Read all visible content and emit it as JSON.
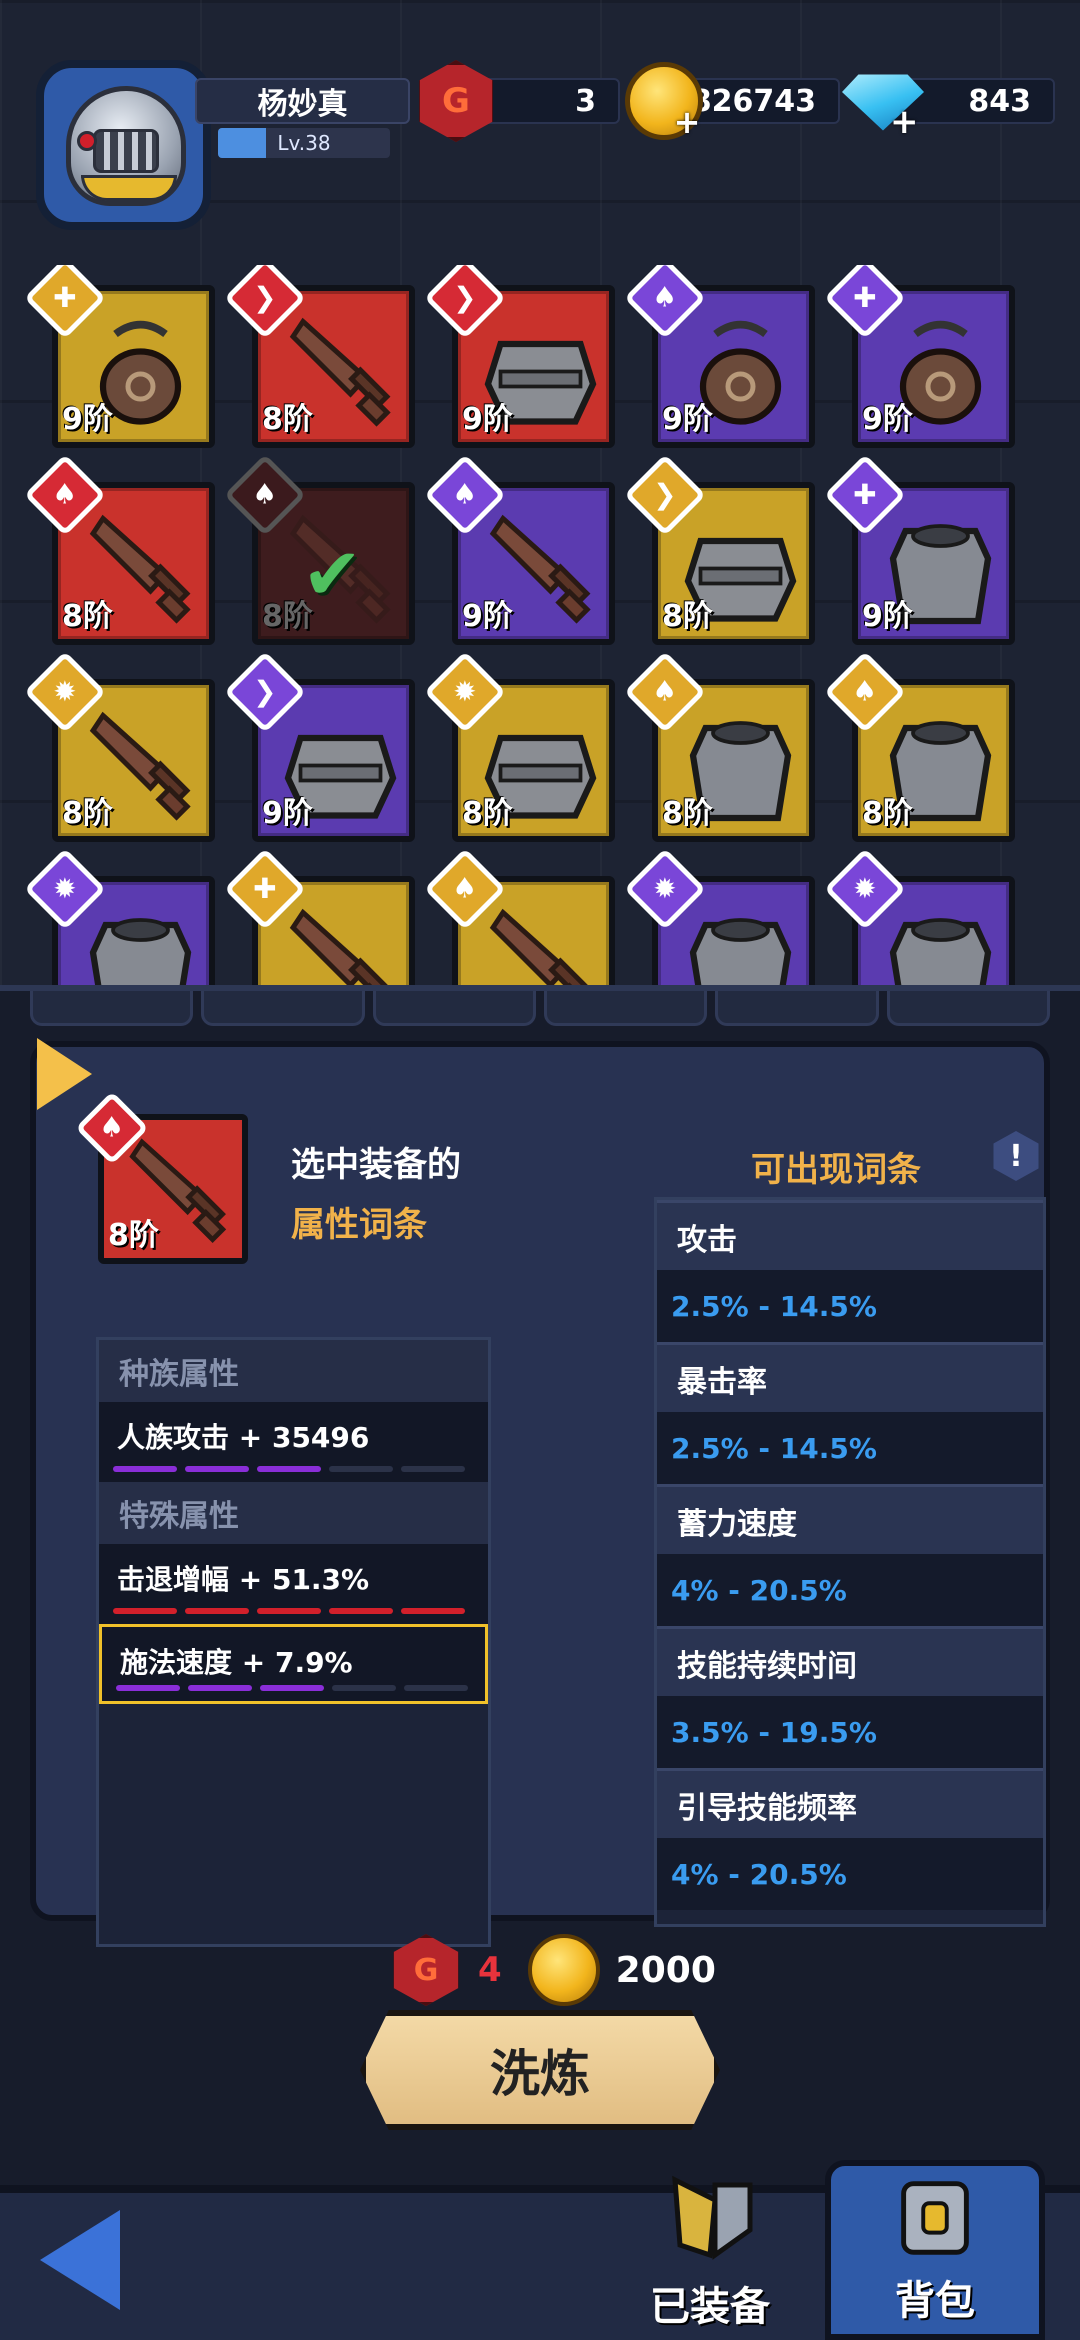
{
  "player": {
    "name": "杨妙真",
    "level": "Lv.38",
    "level_progress": 0.28
  },
  "currencies": {
    "gems": "3",
    "gold": "4826743",
    "diamonds": "843"
  },
  "items": [
    {
      "tier": "9阶",
      "color": "gold",
      "badge": "gold-wrench",
      "kind": "bag"
    },
    {
      "tier": "8阶",
      "color": "red",
      "badge": "red-wing",
      "kind": "sword"
    },
    {
      "tier": "9阶",
      "color": "red",
      "badge": "red-wing",
      "kind": "armor"
    },
    {
      "tier": "9阶",
      "color": "purple",
      "badge": "purple-flame",
      "kind": "bag"
    },
    {
      "tier": "9阶",
      "color": "purple",
      "badge": "purple-wrench",
      "kind": "bag"
    },
    {
      "tier": "8阶",
      "color": "red",
      "badge": "red-flame",
      "kind": "sword"
    },
    {
      "tier": "8阶",
      "color": "dim",
      "badge": "dim-flame",
      "kind": "sword",
      "equipped": true
    },
    {
      "tier": "9阶",
      "color": "purple",
      "badge": "purple-flame",
      "kind": "sword"
    },
    {
      "tier": "8阶",
      "color": "gold",
      "badge": "gold-wing",
      "kind": "armor"
    },
    {
      "tier": "9阶",
      "color": "purple",
      "badge": "purple-wrench",
      "kind": "vest"
    },
    {
      "tier": "8阶",
      "color": "gold",
      "badge": "gold-crest",
      "kind": "sword"
    },
    {
      "tier": "9阶",
      "color": "purple",
      "badge": "purple-wing",
      "kind": "armor"
    },
    {
      "tier": "8阶",
      "color": "gold",
      "badge": "gold-crest",
      "kind": "armor"
    },
    {
      "tier": "8阶",
      "color": "gold",
      "badge": "gold-flame",
      "kind": "vest"
    },
    {
      "tier": "8阶",
      "color": "gold",
      "badge": "gold-flame",
      "kind": "vest"
    },
    {
      "tier": "",
      "color": "purple",
      "badge": "purple-crest",
      "kind": "vest"
    },
    {
      "tier": "",
      "color": "gold",
      "badge": "gold-wrench",
      "kind": "sword"
    },
    {
      "tier": "",
      "color": "gold",
      "badge": "gold-flame",
      "kind": "sword"
    },
    {
      "tier": "",
      "color": "purple",
      "badge": "purple-crest",
      "kind": "vest"
    },
    {
      "tier": "",
      "color": "purple",
      "badge": "purple-crest",
      "kind": "vest"
    }
  ],
  "selected": {
    "tier": "8阶",
    "title_line1": "选中装备的",
    "title_line2": "属性词条"
  },
  "race_section": {
    "heading": "种族属性",
    "rows": [
      {
        "text": "人族攻击 + 35496",
        "pips": [
          "purple",
          "purple",
          "purple",
          "empty",
          "empty"
        ]
      }
    ]
  },
  "special_section": {
    "heading": "特殊属性",
    "rows": [
      {
        "text": "击退增幅 + 51.3%",
        "pips": [
          "red",
          "red",
          "red",
          "red",
          "red"
        ]
      },
      {
        "text": "施法速度 + 7.9%",
        "pips": [
          "purple",
          "purple",
          "purple",
          "empty",
          "empty"
        ],
        "selected": true
      }
    ]
  },
  "available": {
    "title": "可出现词条",
    "info_symbol": "!",
    "entries": [
      {
        "name": "攻击",
        "range": "2.5% - 14.5%"
      },
      {
        "name": "暴击率",
        "range": "2.5% - 14.5%"
      },
      {
        "name": "蓄力速度",
        "range": "4% - 20.5%"
      },
      {
        "name": "技能持续时间",
        "range": "3.5% - 19.5%"
      },
      {
        "name": "引导技能频率",
        "range": "4% - 20.5%"
      }
    ]
  },
  "cost": {
    "gem_cost": "4",
    "gold_cost": "2000"
  },
  "refine_button": "洗炼",
  "nav": {
    "equipped": "已装备",
    "backpack": "背包"
  },
  "colors": {
    "rarity_red": "#c9322c",
    "rarity_purple": "#5b3bb0",
    "rarity_gold": "#c9a227",
    "accent_gold_text": "#f1b24a",
    "range_blue": "#3a9cf0"
  }
}
